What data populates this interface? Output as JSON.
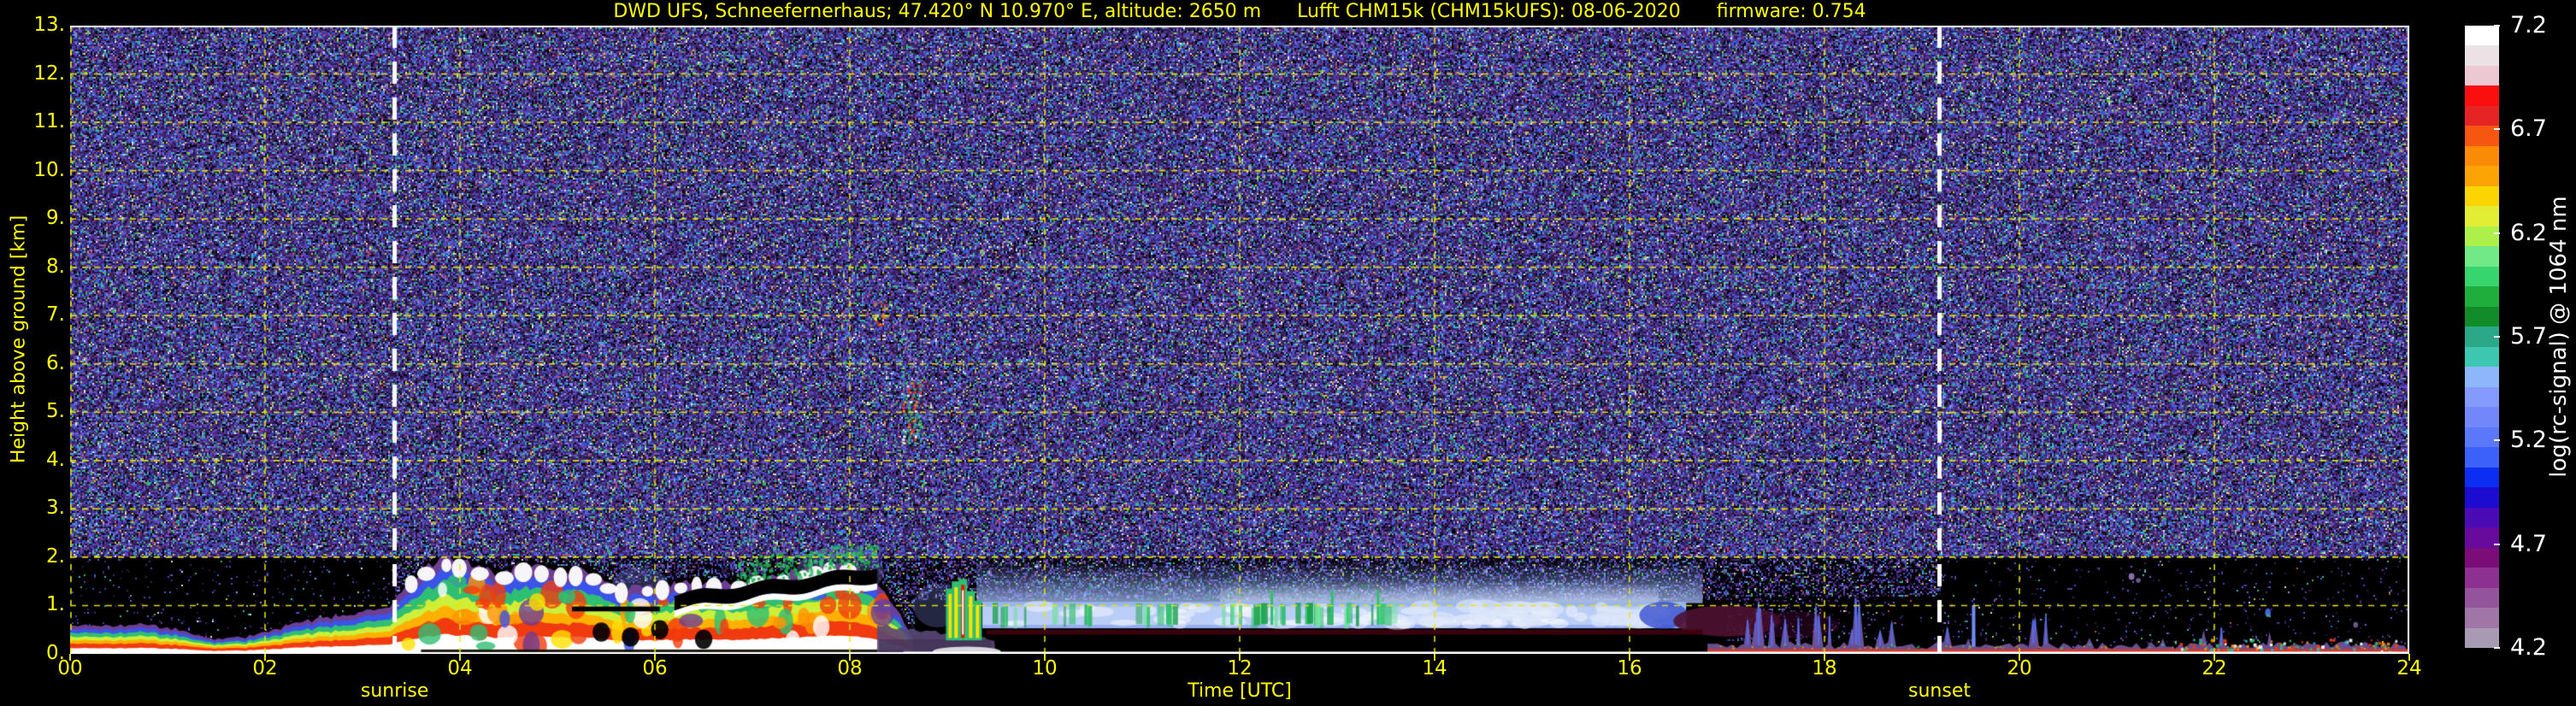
{
  "header": {
    "station": "DWD UFS, Schneefernerhaus; 47.420° N 10.970° E, altitude: 2650 m",
    "instrument": "Lufft CHM15k (CHM15kUFS): 08-06-2020",
    "firmware": "firmware: 0.754"
  },
  "colors": {
    "background": "#000000",
    "label_yellow": "#ffff00",
    "label_white": "#ffffff",
    "grid_yellow": "#e8e200",
    "sun_line_white": "#ffffff"
  },
  "chart_data": {
    "type": "heatmap",
    "title": "DWD UFS, Schneefernerhaus; 47.420° N 10.970° E, altitude: 2650 m  Lufft CHM15k (CHM15kUFS): 08-06-2020  firmware: 0.754",
    "xlabel": "Time [UTC]",
    "ylabel": "Height above ground [km]",
    "x_range_hours": [
      0,
      24
    ],
    "y_range_km": [
      0,
      13
    ],
    "x_tick_hours": [
      0,
      2,
      4,
      6,
      8,
      10,
      12,
      14,
      16,
      18,
      20,
      22,
      24
    ],
    "x_tick_labels": [
      "00",
      "02",
      "04",
      "06",
      "08",
      "10",
      "12",
      "14",
      "16",
      "18",
      "20",
      "22",
      "24"
    ],
    "y_tick_km": [
      0,
      1,
      2,
      3,
      4,
      5,
      6,
      7,
      8,
      9,
      10,
      11,
      12,
      13
    ],
    "y_tick_labels": [
      "0.",
      "1.",
      "2.",
      "3.",
      "4.",
      "5.",
      "6.",
      "7.",
      "8.",
      "9.",
      "10.",
      "11.",
      "12.",
      "13."
    ],
    "grid": "dashed yellow every 2 h and every 1 km",
    "legend_position": "right colorbar",
    "colorbar": {
      "label": "log(rc-signal) @ 1064 nm",
      "value_range": [
        4.2,
        7.2
      ],
      "tick_values": [
        7.2,
        6.7,
        6.2,
        5.7,
        5.2,
        4.7,
        4.2
      ],
      "tick_labels": [
        "7.2",
        "6.7",
        "6.2",
        "5.7",
        "5.2",
        "4.7",
        "4.2"
      ],
      "segments_top_to_bottom": [
        "#ffffff",
        "#eae2e5",
        "#ecc9d2",
        "#fb0e0e",
        "#e62424",
        "#f65710",
        "#fa8b06",
        "#fba303",
        "#fcd402",
        "#e2ee33",
        "#adf04a",
        "#70e986",
        "#38d46e",
        "#1fae3c",
        "#128c2a",
        "#2aa887",
        "#3cc8b0",
        "#8db6fc",
        "#849afc",
        "#7288fa",
        "#5c78fa",
        "#3c60fa",
        "#0b2ef2",
        "#1c0cd2",
        "#4a0ab4",
        "#680b9c",
        "#7a0d78",
        "#8c3092",
        "#94549c",
        "#9f76a7",
        "#a89ab2"
      ]
    },
    "annotations": {
      "sunrise": {
        "label": "sunrise",
        "time_utc": 3.33
      },
      "sunset": {
        "label": "sunset",
        "time_utc": 19.18
      }
    },
    "features": {
      "noise_field": {
        "dense_above_km": 2.0,
        "day_noise_floor_km": 1.12
      },
      "morning_boundary_layer": {
        "time_utc": [
          0,
          8.65
        ],
        "top_km_profile": [
          [
            0,
            0.55
          ],
          [
            0.7,
            0.62
          ],
          [
            1.1,
            0.5
          ],
          [
            1.45,
            0.3
          ],
          [
            1.8,
            0.35
          ],
          [
            2.2,
            0.55
          ],
          [
            2.6,
            0.75
          ],
          [
            3.0,
            0.85
          ],
          [
            3.3,
            1.0
          ],
          [
            3.5,
            1.55
          ],
          [
            3.8,
            2.0
          ],
          [
            4.1,
            1.85
          ],
          [
            4.4,
            1.65
          ],
          [
            4.7,
            1.85
          ],
          [
            5.0,
            1.7
          ],
          [
            5.3,
            1.75
          ],
          [
            5.6,
            1.35
          ],
          [
            6.0,
            1.4
          ],
          [
            6.4,
            1.5
          ],
          [
            6.8,
            1.45
          ],
          [
            7.2,
            1.6
          ],
          [
            7.6,
            1.75
          ],
          [
            7.9,
            1.9
          ],
          [
            8.15,
            1.7
          ],
          [
            8.35,
            1.3
          ],
          [
            8.55,
            0.7
          ],
          [
            8.65,
            0.3
          ]
        ]
      },
      "attenuation_band": {
        "time_utc": [
          6.2,
          8.28
        ],
        "base_km_start": 0.93,
        "base_km_end": 1.5
      },
      "virga": {
        "time_utc": [
          8.5,
          9.0
        ],
        "from_km": 7.0,
        "to_km": 4.1
      },
      "shower_columns": {
        "times_utc": [
          9.03,
          9.09,
          9.16,
          9.24,
          9.31
        ],
        "top_km": [
          1.35,
          1.5,
          1.55,
          1.3,
          1.1
        ],
        "base_km": 0.28
      },
      "stratus_band": {
        "time_utc": [
          9.36,
          16.58
        ],
        "base_km": 0.53,
        "top_km": 1.07,
        "green_streaks_until_utc": 13.6,
        "tall_green_spikes_utc": [
          12.33,
          12.95,
          13.42
        ]
      },
      "evening_residual": {
        "time_utc": [
          16.5,
          18.0
        ],
        "km": [
          0.35,
          1.0
        ]
      },
      "evening_plumes": {
        "time_utc": [
          17.1,
          23.9
        ],
        "top_km_range": [
          0.2,
          1.3
        ],
        "bright_plume_utc": 19.53
      },
      "surface_layer": {
        "time_utc": [
          16.8,
          24
        ],
        "top_km": 0.25
      }
    }
  }
}
